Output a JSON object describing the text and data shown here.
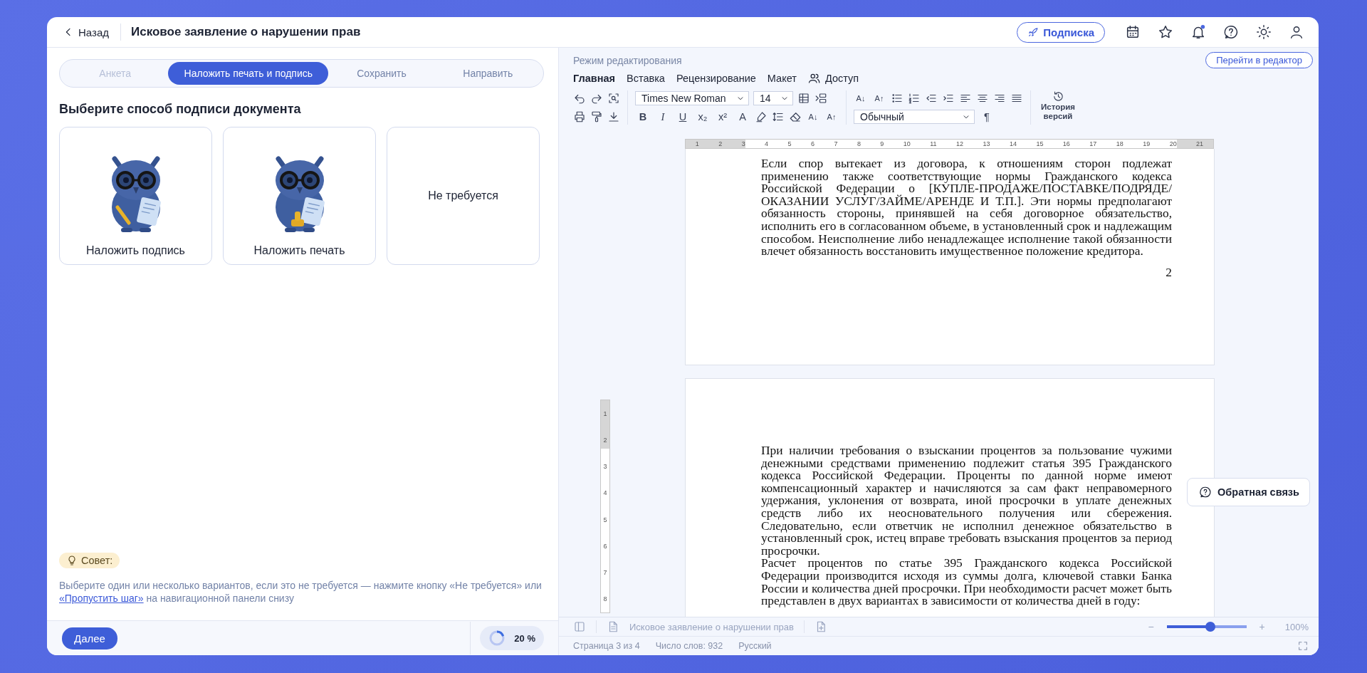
{
  "header": {
    "back": "Назад",
    "title": "Исковое заявление о нарушении прав",
    "subscription": "Подписка"
  },
  "steps": [
    {
      "label": "Анкета",
      "selected": false,
      "disabled": true
    },
    {
      "label": "Наложить печать и подпись",
      "selected": true,
      "disabled": false
    },
    {
      "label": "Сохранить",
      "selected": false,
      "disabled": false
    },
    {
      "label": "Направить",
      "selected": false,
      "disabled": false
    }
  ],
  "heading": "Выберите способ подписи документа",
  "options": [
    {
      "kind": "owl-pen",
      "label": "Наложить подпись"
    },
    {
      "kind": "owl-stamp",
      "label": "Наложить печать"
    },
    {
      "kind": "text",
      "label": "Не требуется"
    }
  ],
  "tip": {
    "badge": "Совет:",
    "text_before": "Выберите один или несколько вариантов, если это не требуется — нажмите кнопку «Не требуется» или ",
    "link": "«Пропустить шаг»",
    "text_after": " на навигационной панели снизу"
  },
  "footer": {
    "next": "Далее",
    "progress": {
      "level": 0.2,
      "reading": "20 %"
    }
  },
  "editor": {
    "mode": "Режим редактирования",
    "open_editor": "Перейти в редактор",
    "menu": [
      {
        "label": "Главная",
        "selected": true,
        "kind": "plain"
      },
      {
        "label": "Вставка",
        "selected": false,
        "kind": "plain"
      },
      {
        "label": "Рецензирование",
        "selected": false,
        "kind": "plain"
      },
      {
        "label": "Макет",
        "selected": false,
        "kind": "plain"
      },
      {
        "label": "Доступ",
        "selected": false,
        "kind": "people"
      }
    ],
    "toolbar": {
      "font": "Times New Roman",
      "size": "14",
      "style": "Обычный",
      "row1_glyphs": [
        "A↓",
        "A↑"
      ],
      "row2_glyphs": [
        "B",
        "I",
        "U",
        "x₂",
        "x²",
        "A"
      ],
      "row2_size_glyphs": [
        "A↓",
        "A↑"
      ],
      "pilcrow": "¶",
      "history": "История версий"
    }
  },
  "ruler": {
    "h_marks": [
      "1",
      "2",
      "3",
      "4",
      "5",
      "6",
      "7",
      "8",
      "9",
      "10",
      "11",
      "12",
      "13",
      "14",
      "15",
      "16",
      "17",
      "18",
      "19",
      "20",
      "21"
    ],
    "v_marks": [
      "1",
      "2",
      "3",
      "4",
      "5",
      "6",
      "7",
      "8"
    ]
  },
  "document": {
    "pages": [
      {
        "paragraphs": [
          "Если спор вытекает из договора, к отношениям сторон подлежат применению также соответствующие нормы Гражданского кодекса Российской Федерации о [КУПЛЕ-ПРОДАЖЕ/ПОСТАВКЕ/ПОДРЯДЕ/ ОКАЗАНИИ УСЛУГ/ЗАЙМЕ/АРЕНДЕ И Т.П.]. Эти нормы предполагают обязанность стороны, принявшей на себя договорное обязательство, исполнить его в согласованном объеме, в установленный срок и надлежащим способом. Неисполнение либо ненадлежащее исполнение такой обязанности влечет обязанность восстановить имущественное положение кредитора."
        ],
        "page_number": "2"
      },
      {
        "paragraphs": [
          "При наличии требования о взыскании процентов за пользование чужими денежными средствами применению подлежит статья 395 Гражданского кодекса Российской Федерации. Проценты по данной норме имеют компенсационный характер и начисляются за сам факт неправомерного удержания, уклонения от возврата, иной просрочки в уплате денежных средств либо их неосновательного получения или сбережения. Следовательно, если ответчик не исполнил денежное обязательство в установленный срок, истец вправе требовать взыскания процентов за период просрочки.",
          "Расчет процентов по статье 395 Гражданского кодекса Российской Федерации производится исходя из суммы долга, ключевой ставки Банка России и количества дней просрочки. При необходимости расчет может быть представлен в двух вариантах в зависимости от количества дней в году:"
        ]
      }
    ]
  },
  "feedback": "Обратная связь",
  "status": {
    "doc_title": "Исковое заявление о нарушении прав",
    "zoom_minus": "−",
    "zoom_slider": {
      "level": 0.55
    },
    "zoom_plus": "+",
    "zoom_reading": "100%",
    "page": "Страница 3 из 4",
    "words": "Число слов: 932",
    "language": "Русский"
  }
}
